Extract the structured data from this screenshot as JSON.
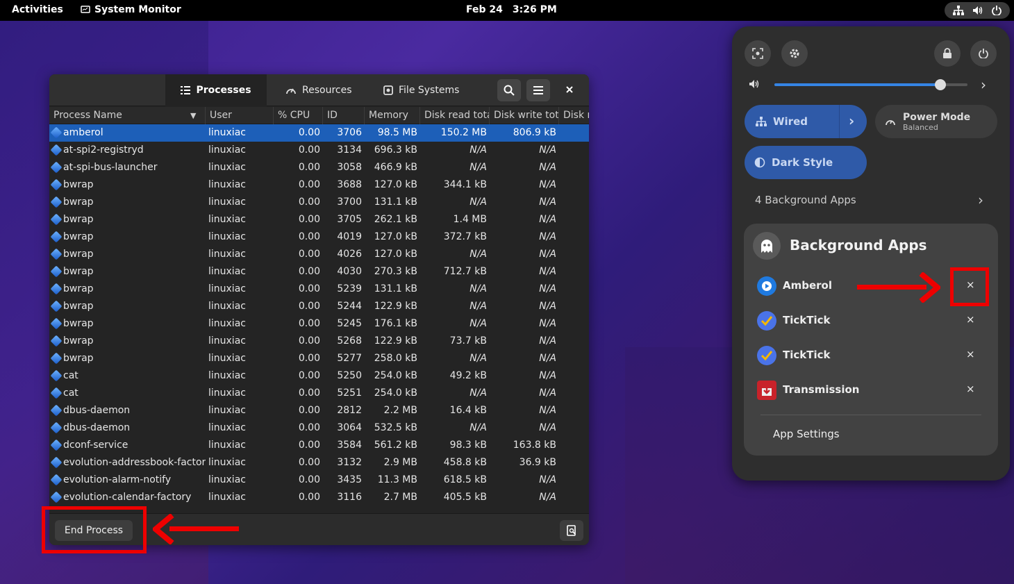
{
  "topbar": {
    "activities": "Activities",
    "app_name": "System Monitor",
    "date": "Feb 24",
    "time": "3:26 PM"
  },
  "window": {
    "tabs": [
      {
        "label": "Processes",
        "icon": "list-icon",
        "active": true
      },
      {
        "label": "Resources",
        "icon": "gauge-icon",
        "active": false
      },
      {
        "label": "File Systems",
        "icon": "disk-icon",
        "active": false
      }
    ],
    "columns": [
      "Process Name",
      "User",
      "% CPU",
      "ID",
      "Memory",
      "Disk read tota",
      "Disk write tot",
      "Disk r"
    ],
    "selected_row": 0,
    "rows": [
      {
        "name": "amberol",
        "user": "linuxiac",
        "cpu": "0.00",
        "id": "3706",
        "mem": "98.5 MB",
        "dr": "150.2 MB",
        "dw": "806.9 kB"
      },
      {
        "name": "at-spi2-registryd",
        "user": "linuxiac",
        "cpu": "0.00",
        "id": "3134",
        "mem": "696.3 kB",
        "dr": "N/A",
        "dw": "N/A"
      },
      {
        "name": "at-spi-bus-launcher",
        "user": "linuxiac",
        "cpu": "0.00",
        "id": "3058",
        "mem": "466.9 kB",
        "dr": "N/A",
        "dw": "N/A"
      },
      {
        "name": "bwrap",
        "user": "linuxiac",
        "cpu": "0.00",
        "id": "3688",
        "mem": "127.0 kB",
        "dr": "344.1 kB",
        "dw": "N/A"
      },
      {
        "name": "bwrap",
        "user": "linuxiac",
        "cpu": "0.00",
        "id": "3700",
        "mem": "131.1 kB",
        "dr": "N/A",
        "dw": "N/A"
      },
      {
        "name": "bwrap",
        "user": "linuxiac",
        "cpu": "0.00",
        "id": "3705",
        "mem": "262.1 kB",
        "dr": "1.4 MB",
        "dw": "N/A"
      },
      {
        "name": "bwrap",
        "user": "linuxiac",
        "cpu": "0.00",
        "id": "4019",
        "mem": "127.0 kB",
        "dr": "372.7 kB",
        "dw": "N/A"
      },
      {
        "name": "bwrap",
        "user": "linuxiac",
        "cpu": "0.00",
        "id": "4026",
        "mem": "127.0 kB",
        "dr": "N/A",
        "dw": "N/A"
      },
      {
        "name": "bwrap",
        "user": "linuxiac",
        "cpu": "0.00",
        "id": "4030",
        "mem": "270.3 kB",
        "dr": "712.7 kB",
        "dw": "N/A"
      },
      {
        "name": "bwrap",
        "user": "linuxiac",
        "cpu": "0.00",
        "id": "5239",
        "mem": "131.1 kB",
        "dr": "N/A",
        "dw": "N/A"
      },
      {
        "name": "bwrap",
        "user": "linuxiac",
        "cpu": "0.00",
        "id": "5244",
        "mem": "122.9 kB",
        "dr": "N/A",
        "dw": "N/A"
      },
      {
        "name": "bwrap",
        "user": "linuxiac",
        "cpu": "0.00",
        "id": "5245",
        "mem": "176.1 kB",
        "dr": "N/A",
        "dw": "N/A"
      },
      {
        "name": "bwrap",
        "user": "linuxiac",
        "cpu": "0.00",
        "id": "5268",
        "mem": "122.9 kB",
        "dr": "73.7 kB",
        "dw": "N/A"
      },
      {
        "name": "bwrap",
        "user": "linuxiac",
        "cpu": "0.00",
        "id": "5277",
        "mem": "258.0 kB",
        "dr": "N/A",
        "dw": "N/A"
      },
      {
        "name": "cat",
        "user": "linuxiac",
        "cpu": "0.00",
        "id": "5250",
        "mem": "254.0 kB",
        "dr": "49.2 kB",
        "dw": "N/A"
      },
      {
        "name": "cat",
        "user": "linuxiac",
        "cpu": "0.00",
        "id": "5251",
        "mem": "254.0 kB",
        "dr": "N/A",
        "dw": "N/A"
      },
      {
        "name": "dbus-daemon",
        "user": "linuxiac",
        "cpu": "0.00",
        "id": "2812",
        "mem": "2.2 MB",
        "dr": "16.4 kB",
        "dw": "N/A"
      },
      {
        "name": "dbus-daemon",
        "user": "linuxiac",
        "cpu": "0.00",
        "id": "3064",
        "mem": "532.5 kB",
        "dr": "N/A",
        "dw": "N/A"
      },
      {
        "name": "dconf-service",
        "user": "linuxiac",
        "cpu": "0.00",
        "id": "3584",
        "mem": "561.2 kB",
        "dr": "98.3 kB",
        "dw": "163.8 kB"
      },
      {
        "name": "evolution-addressbook-factory",
        "user": "linuxiac",
        "cpu": "0.00",
        "id": "3132",
        "mem": "2.9 MB",
        "dr": "458.8 kB",
        "dw": "36.9 kB"
      },
      {
        "name": "evolution-alarm-notify",
        "user": "linuxiac",
        "cpu": "0.00",
        "id": "3435",
        "mem": "11.3 MB",
        "dr": "618.5 kB",
        "dw": "N/A"
      },
      {
        "name": "evolution-calendar-factory",
        "user": "linuxiac",
        "cpu": "0.00",
        "id": "3116",
        "mem": "2.7 MB",
        "dr": "405.5 kB",
        "dw": "N/A"
      }
    ],
    "end_process_label": "End Process"
  },
  "quick_settings": {
    "volume_fraction": 0.86,
    "wired_label": "Wired",
    "power_mode_label": "Power Mode",
    "power_mode_value": "Balanced",
    "dark_style_label": "Dark Style",
    "background_apps_summary": "4 Background Apps",
    "submenu_title": "Background Apps",
    "apps": [
      {
        "name": "Amberol",
        "icon": "amberol-icon",
        "color": "#1f7ae0"
      },
      {
        "name": "TickTick",
        "icon": "ticktick-icon",
        "color": "#4a73e8"
      },
      {
        "name": "TickTick",
        "icon": "ticktick-icon",
        "color": "#4a73e8"
      },
      {
        "name": "Transmission",
        "icon": "transmission-icon",
        "color": "#c8222a"
      }
    ],
    "close_glyph": "×",
    "app_settings_label": "App Settings"
  },
  "colors": {
    "accent": "#3584e4",
    "selection": "#1d5fb8",
    "annotation": "#ee0000"
  }
}
